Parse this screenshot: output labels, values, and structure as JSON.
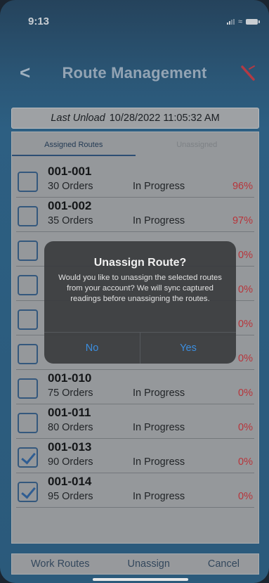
{
  "status_bar": {
    "time": "9:13",
    "signal_icon": "signal-icon",
    "wifi_icon": "wifi-icon",
    "battery_icon": "battery-icon"
  },
  "header": {
    "back_glyph": "<",
    "title": "Route Management",
    "sync_icon": "sync-disabled-icon"
  },
  "last_unload": {
    "label": "Last Unload",
    "value": "10/28/2022 11:05:32 AM"
  },
  "tabs": [
    {
      "label": "Assigned Routes",
      "active": true
    },
    {
      "label": "Unassigned",
      "active": false
    }
  ],
  "routes": [
    {
      "name": "001-001",
      "orders": "30 Orders",
      "status": "In Progress",
      "percent": "96%",
      "checked": false,
      "hidden": false
    },
    {
      "name": "001-002",
      "orders": "35 Orders",
      "status": "In Progress",
      "percent": "97%",
      "checked": false,
      "hidden": false
    },
    {
      "name": "",
      "orders": "",
      "status": "",
      "percent": "0%",
      "checked": false,
      "hidden": true
    },
    {
      "name": "",
      "orders": "",
      "status": "",
      "percent": "0%",
      "checked": false,
      "hidden": true
    },
    {
      "name": "",
      "orders": "",
      "status": "",
      "percent": "0%",
      "checked": false,
      "hidden": true
    },
    {
      "name": "",
      "orders": "",
      "status": "",
      "percent": "0%",
      "checked": false,
      "hidden": true
    },
    {
      "name": "001-010",
      "orders": "75 Orders",
      "status": "In Progress",
      "percent": "0%",
      "checked": false,
      "hidden": false
    },
    {
      "name": "001-011",
      "orders": "80 Orders",
      "status": "In Progress",
      "percent": "0%",
      "checked": false,
      "hidden": false
    },
    {
      "name": "001-013",
      "orders": "90 Orders",
      "status": "In Progress",
      "percent": "0%",
      "checked": true,
      "hidden": false
    },
    {
      "name": "001-014",
      "orders": "95 Orders",
      "status": "In Progress",
      "percent": "0%",
      "checked": true,
      "hidden": false
    }
  ],
  "bottom_bar": {
    "work_routes": "Work Routes",
    "unassign": "Unassign",
    "cancel": "Cancel"
  },
  "dialog": {
    "title": "Unassign Route?",
    "message": "Would you like to unassign the selected routes from your account? We will sync captured readings before unassigning the routes.",
    "no_label": "No",
    "yes_label": "Yes"
  },
  "colors": {
    "accent": "#3b8ee0",
    "percent_red": "#b8343a",
    "checkbox_blue": "#34587d"
  }
}
